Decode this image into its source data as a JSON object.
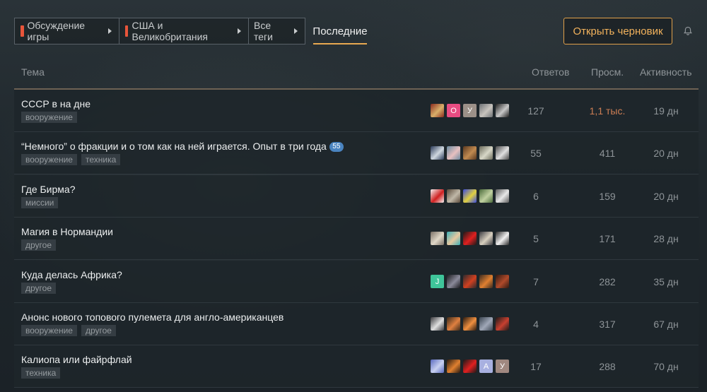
{
  "nav": {
    "crumbs": [
      {
        "label": "Обсуждение игры",
        "accent": "#e8553a"
      },
      {
        "label": "США и Великобритания",
        "accent": "#e8553a"
      },
      {
        "label": "Все теги"
      }
    ],
    "active_tab": "Последние"
  },
  "actions": {
    "draft_button": "Открыть черновик",
    "notifications_icon": "bell-icon"
  },
  "table": {
    "headers": {
      "topic": "Тема",
      "replies": "Ответов",
      "views": "Просм.",
      "activity": "Активность"
    },
    "rows": [
      {
        "title": "СССР в на дне",
        "badge": "",
        "tags": [
          "вооружение"
        ],
        "replies": "127",
        "views": "1,1 тыс.",
        "views_hot": true,
        "activity": "19 дн",
        "avatars": [
          {
            "type": "image",
            "colors": [
              "#8a2a1e",
              "#d9b06a"
            ]
          },
          {
            "type": "letter",
            "letter": "О",
            "color": "#e84c82"
          },
          {
            "type": "letter",
            "letter": "У",
            "color": "#9c9088"
          },
          {
            "type": "image",
            "colors": [
              "#6c7074",
              "#c8c4be"
            ]
          },
          {
            "type": "image",
            "colors": [
              "#1e1e1e",
              "#c8c8c8"
            ]
          }
        ]
      },
      {
        "title": "“Немного” о фракции и о том как на ней играется. Опыт в три года",
        "badge": "55",
        "tags": [
          "вооружение",
          "техника"
        ],
        "replies": "55",
        "views": "411",
        "views_hot": false,
        "activity": "20 дн",
        "avatars": [
          {
            "type": "image",
            "colors": [
              "#2a3a58",
              "#d0d8e0"
            ]
          },
          {
            "type": "image",
            "colors": [
              "#6a8aa0",
              "#e8c0c0"
            ]
          },
          {
            "type": "image",
            "colors": [
              "#5a3820",
              "#c08a50"
            ]
          },
          {
            "type": "image",
            "colors": [
              "#6a6a5a",
              "#d8d8c8"
            ]
          },
          {
            "type": "image",
            "colors": [
              "#4a4a4a",
              "#e0e0e0"
            ]
          }
        ]
      },
      {
        "title": "Где Бирма?",
        "badge": "",
        "tags": [
          "миссии"
        ],
        "replies": "6",
        "views": "159",
        "views_hot": false,
        "activity": "20 дн",
        "avatars": [
          {
            "type": "image",
            "colors": [
              "#f4f4f4",
              "#d02020"
            ]
          },
          {
            "type": "image",
            "colors": [
              "#5a4a3a",
              "#c0b8a8"
            ]
          },
          {
            "type": "image",
            "colors": [
              "#3a4ae0",
              "#e0d040"
            ]
          },
          {
            "type": "image",
            "colors": [
              "#4a6a3a",
              "#c0d0a0"
            ]
          },
          {
            "type": "image",
            "colors": [
              "#5a5a5a",
              "#e8e8e8"
            ]
          }
        ]
      },
      {
        "title": "Магия в Нормандии",
        "badge": "",
        "tags": [
          "другое"
        ],
        "replies": "5",
        "views": "171",
        "views_hot": false,
        "activity": "28 дн",
        "avatars": [
          {
            "type": "image",
            "colors": [
              "#7a7066",
              "#e0d8c8"
            ]
          },
          {
            "type": "image",
            "colors": [
              "#3ab0b8",
              "#e8c8a0"
            ]
          },
          {
            "type": "image",
            "colors": [
              "#1a1a1a",
              "#e02020"
            ]
          },
          {
            "type": "image",
            "colors": [
              "#3a3a40",
              "#d8d0c0"
            ]
          },
          {
            "type": "image",
            "colors": [
              "#2a2a2a",
              "#f0f0f0"
            ]
          }
        ]
      },
      {
        "title": "Куда делась Африка?",
        "badge": "",
        "tags": [
          "другое"
        ],
        "replies": "7",
        "views": "282",
        "views_hot": false,
        "activity": "35 дн",
        "avatars": [
          {
            "type": "letter",
            "letter": "J",
            "color": "#3fc59a"
          },
          {
            "type": "image",
            "colors": [
              "#1a1a1e",
              "#8a8a9a"
            ]
          },
          {
            "type": "image",
            "colors": [
              "#2a2a2e",
              "#d04020"
            ]
          },
          {
            "type": "image",
            "colors": [
              "#3a2a20",
              "#e08030"
            ]
          },
          {
            "type": "image",
            "colors": [
              "#301a12",
              "#b04a2a"
            ]
          }
        ]
      },
      {
        "title": "Анонс нового топового пулемета для англо-американцев",
        "badge": "",
        "tags": [
          "вооружение",
          "другое"
        ],
        "replies": "4",
        "views": "317",
        "views_hot": false,
        "activity": "67 дн",
        "avatars": [
          {
            "type": "image",
            "colors": [
              "#3a3a3e",
              "#e0e0e0"
            ]
          },
          {
            "type": "image",
            "colors": [
              "#3a2a1a",
              "#e08040"
            ]
          },
          {
            "type": "image",
            "colors": [
              "#2a1a10",
              "#f09040"
            ]
          },
          {
            "type": "image",
            "colors": [
              "#3a4450",
              "#a0a8b8"
            ]
          },
          {
            "type": "image",
            "colors": [
              "#1a1a1a",
              "#c84030"
            ]
          }
        ]
      },
      {
        "title": "Калиопа или файрфлай",
        "badge": "",
        "tags": [
          "техника"
        ],
        "replies": "17",
        "views": "288",
        "views_hot": false,
        "activity": "70 дн",
        "avatars": [
          {
            "type": "image",
            "colors": [
              "#5a6ac0",
              "#c8d0f0"
            ]
          },
          {
            "type": "image",
            "colors": [
              "#2a1a10",
              "#e08030"
            ]
          },
          {
            "type": "image",
            "colors": [
              "#1a1a1a",
              "#e02020"
            ]
          },
          {
            "type": "letter",
            "letter": "А",
            "color": "#a8b0e0"
          },
          {
            "type": "letter",
            "letter": "У",
            "color": "#a08880"
          }
        ]
      }
    ]
  }
}
